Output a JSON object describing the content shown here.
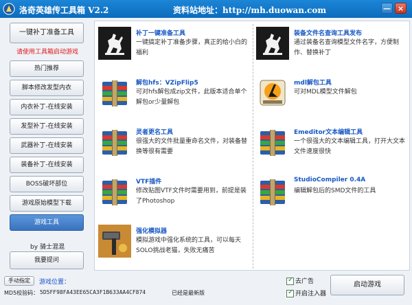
{
  "window": {
    "title": "洛奇英雄传工具箱 V2.2",
    "site": "资料站地址：http://mh.duowan.com",
    "min": "—",
    "close": "×"
  },
  "sidebar": {
    "main_button": "一键补丁准备工具",
    "warning": "请使用工具箱启动游戏",
    "items": [
      {
        "label": "热门推荐"
      },
      {
        "label": "脚本修改发型内衣"
      },
      {
        "label": "内衣补丁-在线安装"
      },
      {
        "label": "发型补丁-在线安装"
      },
      {
        "label": "武器补丁-在线安装"
      },
      {
        "label": "装备补丁-在线安装"
      },
      {
        "label": "BOSS破坏部位"
      },
      {
        "label": "游戏原始模型下载"
      },
      {
        "label": "游戏工具"
      }
    ],
    "author": "by 骑士混混",
    "ask_button": "我要提问"
  },
  "tools": [
    {
      "name": "补丁一键准备工具",
      "desc": "一键搞定补丁准备步骤，真正的给小白的福利",
      "icon": "knight-icon"
    },
    {
      "name": "装备文件名查询工具发布",
      "desc": "通过装备名查询模型文件名字，方便制作、替换补丁",
      "icon": "knight-icon"
    },
    {
      "name": "解包hfs：VZipFlip5",
      "desc": "可对hfs解包成zip文件，此版本适合单个解包or少量解包",
      "icon": "archive-icon"
    },
    {
      "name": "mdl解包工具",
      "desc": "可对MDL模型文件解包",
      "icon": "mdl-icon"
    },
    {
      "name": "灵者更名工具",
      "desc": "很强大的文件批量重命名文件，对装备替换等很有需要",
      "icon": "archive-icon"
    },
    {
      "name": "Emeditor文本编辑工具",
      "desc": "一个很强大的文本编辑工具，打开大文本文件速度很快",
      "icon": "archive-icon"
    },
    {
      "name": "VTF插件",
      "desc": "修改贴图VTF文件时需要用到，前提是装了Photoshop",
      "icon": "archive-icon"
    },
    {
      "name": "StudioCompiler 0.4A",
      "desc": "编辑解包后的SMD文件的工具",
      "icon": "archive-icon"
    },
    {
      "name": "强化模拟器",
      "desc": "模拟游戏中强化系统的工具，可以每天SOLO挑战老猫，失败无痛苦",
      "icon": "hammer-icon"
    }
  ],
  "bottom": {
    "manual_button": "手动指定",
    "path_label": "游戏位置：",
    "md5_label": "MD5校验码：",
    "md5_value": "5D5FF98FA43EE65CA3F1B633AA4CF874",
    "status": "已经是最新版",
    "check_ads": "去广告",
    "check_inject": "开启注入器",
    "start_button": "启动游戏"
  }
}
